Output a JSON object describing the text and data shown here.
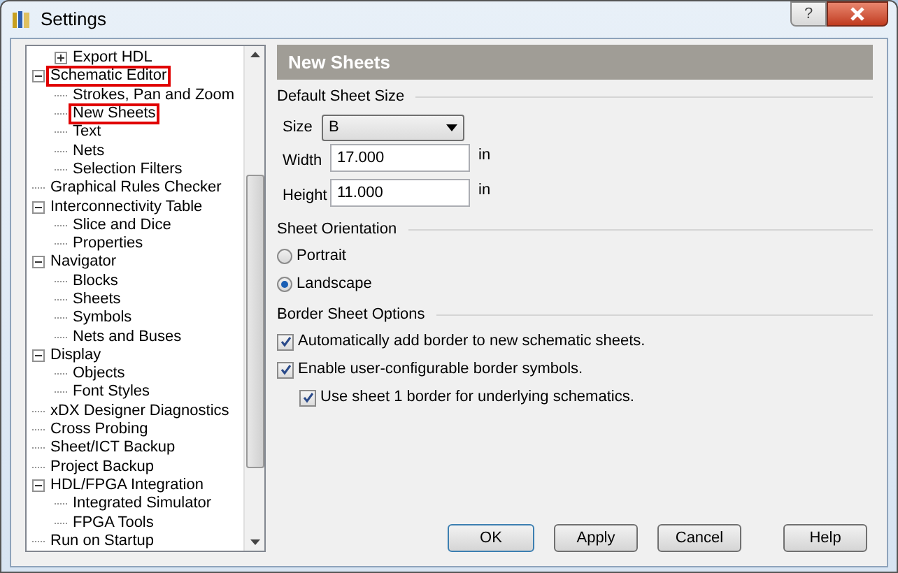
{
  "window": {
    "title": "Settings",
    "buttons": [
      "?"
    ]
  },
  "tree": {
    "items": [
      {
        "children": [
          {
            "label": "Export HDL",
            "expanded": false,
            "highlighted": false
          }
        ]
      },
      {
        "label": "Schematic Editor",
        "expanded": true,
        "highlighted": true,
        "children": [
          {
            "label": "Strokes, Pan and Zoom",
            "highlighted": false
          },
          {
            "label": "New Sheets",
            "highlighted": true
          },
          {
            "label": "Text",
            "highlighted": false
          },
          {
            "label": "Nets",
            "highlighted": false
          },
          {
            "label": "Selection Filters",
            "highlighted": false
          }
        ]
      },
      {
        "label": "Graphical Rules Checker",
        "highlighted": false
      },
      {
        "label": "Interconnectivity Table",
        "expanded": true,
        "highlighted": false,
        "children": [
          {
            "label": "Slice and Dice",
            "highlighted": false
          },
          {
            "label": "Properties",
            "highlighted": false
          }
        ]
      },
      {
        "label": "Navigator",
        "expanded": true,
        "highlighted": false,
        "children": [
          {
            "label": "Blocks",
            "highlighted": false
          },
          {
            "label": "Sheets",
            "highlighted": false
          },
          {
            "label": "Symbols",
            "highlighted": false
          },
          {
            "label": "Nets and Buses",
            "highlighted": false
          }
        ]
      },
      {
        "label": "Display",
        "expanded": true,
        "highlighted": false,
        "children": [
          {
            "label": "Objects",
            "highlighted": false
          },
          {
            "label": "Font Styles",
            "highlighted": false
          }
        ]
      },
      {
        "label": "xDX Designer Diagnostics",
        "highlighted": false
      },
      {
        "label": "Cross Probing",
        "highlighted": false
      },
      {
        "label": "Sheet/ICT Backup",
        "highlighted": false
      },
      {
        "label": "Project Backup",
        "highlighted": false
      },
      {
        "label": "HDL/FPGA Integration",
        "expanded": true,
        "highlighted": false,
        "children": [
          {
            "label": "Integrated Simulator",
            "highlighted": false
          },
          {
            "label": "FPGA Tools",
            "highlighted": false
          }
        ]
      },
      {
        "label": "Run on Startup",
        "highlighted": false
      }
    ]
  },
  "panel": {
    "title": "New Sheets",
    "default_sheet_size": {
      "title": "Default Sheet Size",
      "size": {
        "label": "Size",
        "value": "B"
      },
      "width": {
        "label": "Width",
        "value": "17.000",
        "unit": "in"
      },
      "height": {
        "label": "Height",
        "value": "11.000",
        "unit": "in"
      }
    },
    "sheet_orientation": {
      "title": "Sheet Orientation",
      "options": [
        {
          "label": "Portrait",
          "selected": false
        },
        {
          "label": "Landscape",
          "selected": true
        }
      ]
    },
    "border_sheet_options": {
      "title": "Border Sheet Options",
      "options": [
        {
          "label": "Automatically add border to new schematic sheets.",
          "checked": true,
          "indented": false
        },
        {
          "label": "Enable user-configurable border symbols.",
          "checked": true,
          "indented": false
        },
        {
          "label": "Use sheet 1 border for underlying schematics.",
          "checked": true,
          "indented": true
        }
      ]
    }
  },
  "buttons": [
    {
      "label": "OK",
      "default": true
    },
    {
      "label": "Apply",
      "default": false
    },
    {
      "label": "Cancel",
      "default": false
    },
    {
      "label": "Help",
      "default": false
    }
  ]
}
